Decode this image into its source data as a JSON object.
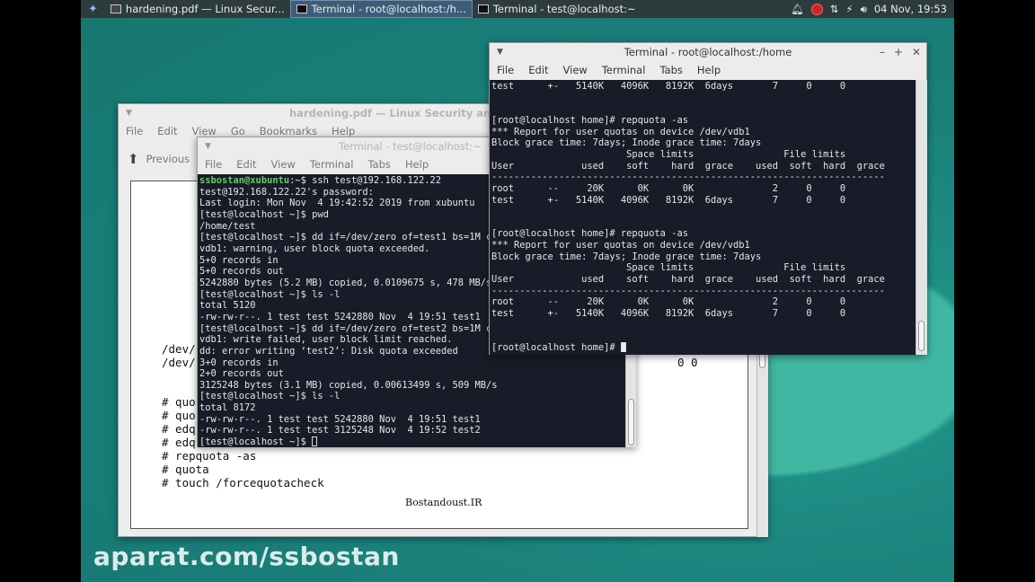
{
  "panel": {
    "tasks": [
      {
        "label": "hardening.pdf — Linux Secur...",
        "active": false
      },
      {
        "label": "Terminal - root@localhost:/h...",
        "active": true
      },
      {
        "label": "Terminal - test@localhost:~",
        "active": false
      }
    ],
    "clock": "04 Nov, 19:53"
  },
  "pdf": {
    "title": "hardening.pdf — Linux Security and Harden",
    "menu": [
      "File",
      "Edit",
      "View",
      "Go",
      "Bookmarks",
      "Help"
    ],
    "previous": "Previous",
    "lines": [
      "/dev/",
      "/dev/",
      "0 0",
      "# quo",
      "# quo",
      "# edq",
      "# edq",
      "# repquota -as",
      "# quota",
      "# touch /forcequotacheck"
    ],
    "footer": "Bostandoust.IR"
  },
  "term_test": {
    "title": "Terminal - test@localhost:~",
    "menu": [
      "File",
      "Edit",
      "View",
      "Terminal",
      "Tabs",
      "Help"
    ],
    "first_user": "ssbostan@xubuntu",
    "first_rest": ":~$ ssh test@192.168.122.22",
    "lines": [
      "test@192.168.122.22's password:",
      "Last login: Mon Nov  4 19:42:52 2019 from xubuntu",
      "[test@localhost ~]$ pwd",
      "/home/test",
      "[test@localhost ~]$ dd if=/dev/zero of=test1 bs=1M count=5",
      "vdb1: warning, user block quota exceeded.",
      "5+0 records in",
      "5+0 records out",
      "5242880 bytes (5.2 MB) copied, 0.0109675 s, 478 MB/s",
      "[test@localhost ~]$ ls -l",
      "total 5120",
      "-rw-rw-r--. 1 test test 5242880 Nov  4 19:51 test1",
      "[test@localhost ~]$ dd if=/dev/zero of=test2 bs=1M count=5",
      "vdb1: write failed, user block limit reached.",
      "dd: error writing ‘test2’: Disk quota exceeded",
      "3+0 records in",
      "2+0 records out",
      "3125248 bytes (3.1 MB) copied, 0.00613499 s, 509 MB/s",
      "[test@localhost ~]$ ls -l",
      "total 8172",
      "-rw-rw-r--. 1 test test 5242880 Nov  4 19:51 test1",
      "-rw-rw-r--. 1 test test 3125248 Nov  4 19:52 test2"
    ],
    "prompt": "[test@localhost ~]$ "
  },
  "term_root": {
    "title": "Terminal - root@localhost:/home",
    "menu": [
      "File",
      "Edit",
      "View",
      "Terminal",
      "Tabs",
      "Help"
    ],
    "lines": [
      "test      +-   5140K   4096K   8192K  6days       7     0     0",
      "",
      "",
      "[root@localhost home]# repquota -as",
      "*** Report for user quotas on device /dev/vdb1",
      "Block grace time: 7days; Inode grace time: 7days",
      "                        Space limits                File limits",
      "User            used    soft    hard  grace    used  soft  hard  grace",
      "----------------------------------------------------------------------",
      "root      --     20K      0K      0K              2     0     0",
      "test      +-   5140K   4096K   8192K  6days       7     0     0",
      "",
      "",
      "[root@localhost home]# repquota -as",
      "*** Report for user quotas on device /dev/vdb1",
      "Block grace time: 7days; Inode grace time: 7days",
      "                        Space limits                File limits",
      "User            used    soft    hard  grace    used  soft  hard  grace",
      "----------------------------------------------------------------------",
      "root      --     20K      0K      0K              2     0     0",
      "test      +-   5140K   4096K   8192K  6days       7     0     0",
      "",
      ""
    ],
    "prompt": "[root@localhost home]# "
  },
  "watermark": "aparat.com/ssbostan"
}
